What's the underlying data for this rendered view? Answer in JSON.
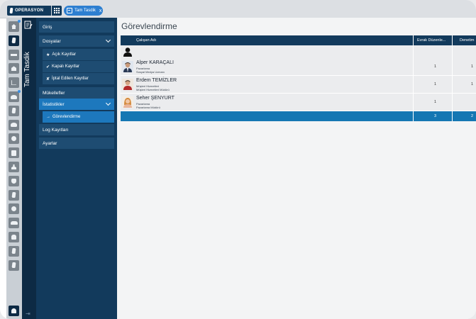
{
  "topbar": {
    "brand_label": "OPERASYON",
    "tab_label": "Tam Tasdik",
    "tab_close": "x"
  },
  "rail": {
    "icons": [
      "home-icon",
      "document-icon",
      "menu-bar-icon",
      "bank-icon",
      "line-chart-icon",
      "people-icon",
      "document-icon",
      "ship-icon",
      "globe-icon",
      "book-icon",
      "person-icon",
      "bag-icon",
      "document-icon",
      "globe-icon",
      "car-icon",
      "hand-icon",
      "document-icon",
      "document-icon",
      "user-settings-icon"
    ]
  },
  "module": {
    "title": "Tam Tasdik",
    "collapse_glyph": "⇥"
  },
  "sidebar": {
    "items": [
      {
        "label": "Giriş",
        "type": "item",
        "prefix": ""
      },
      {
        "label": "Dosyalar",
        "type": "item",
        "prefix": "",
        "chevron": true
      },
      {
        "label": "Açık Kayıtlar",
        "type": "sub",
        "prefix": "★"
      },
      {
        "label": "Kapalı Kayıtlar",
        "type": "sub",
        "prefix": "✔"
      },
      {
        "label": "İptal Edilen Kayıtlar",
        "type": "sub",
        "prefix": "✘"
      },
      {
        "label": "Mükellefler",
        "type": "item",
        "prefix": ""
      },
      {
        "label": "İstatistikler",
        "type": "item",
        "prefix": "",
        "chevron": true,
        "selected": true
      },
      {
        "label": "Görevlendirme",
        "type": "sub",
        "prefix": "→",
        "selected": true
      },
      {
        "label": "Log Kayıtları",
        "type": "item",
        "prefix": ""
      },
      {
        "label": "Ayarlar",
        "type": "item",
        "prefix": ""
      }
    ]
  },
  "main": {
    "title": "Görevlendirme",
    "columns": [
      "Çalışan Adı",
      "Evrak Düzenle...",
      "Denetim"
    ],
    "rows": [
      {
        "name": "Alper KARAÇALI",
        "dept": "Pazarlama",
        "role": "Sosyal Medya Uzmanı",
        "evrak": "1",
        "denetim": "1"
      },
      {
        "name": "Erdem TEMİZLER",
        "dept": "Müşteri Hizmetleri",
        "role": "Müşteri Hizmetleri Müdürü",
        "evrak": "1",
        "denetim": "1"
      },
      {
        "name": "Seher ŞENYURT",
        "dept": "Pazarlama",
        "role": "Pazarlama Müdürü",
        "evrak": "1",
        "denetim": ""
      }
    ],
    "totals": {
      "evrak": "3",
      "denetim": "2"
    }
  },
  "colors": {
    "navy": "#123a5c",
    "accent_blue": "#2d7fd1",
    "footer_blue": "#1577b3"
  }
}
